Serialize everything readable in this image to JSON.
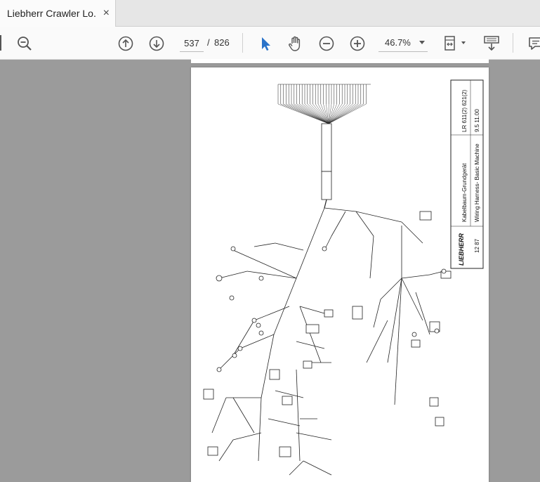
{
  "tab": {
    "title": "Liebherr Crawler Lo...",
    "close_glyph": "×"
  },
  "toolbar": {
    "page_current": "537",
    "page_separator": "/",
    "page_total": "826",
    "zoom": "46.7%"
  },
  "drawing": {
    "brand": "LIEBHERR",
    "title_de": "Kabelbaum-Grundgerät",
    "title_en": "Wiring Harness- Basic Machine",
    "model": "LR 611(2) 621(2)",
    "doc_number": "9.5 11.00",
    "date": "12 87"
  }
}
